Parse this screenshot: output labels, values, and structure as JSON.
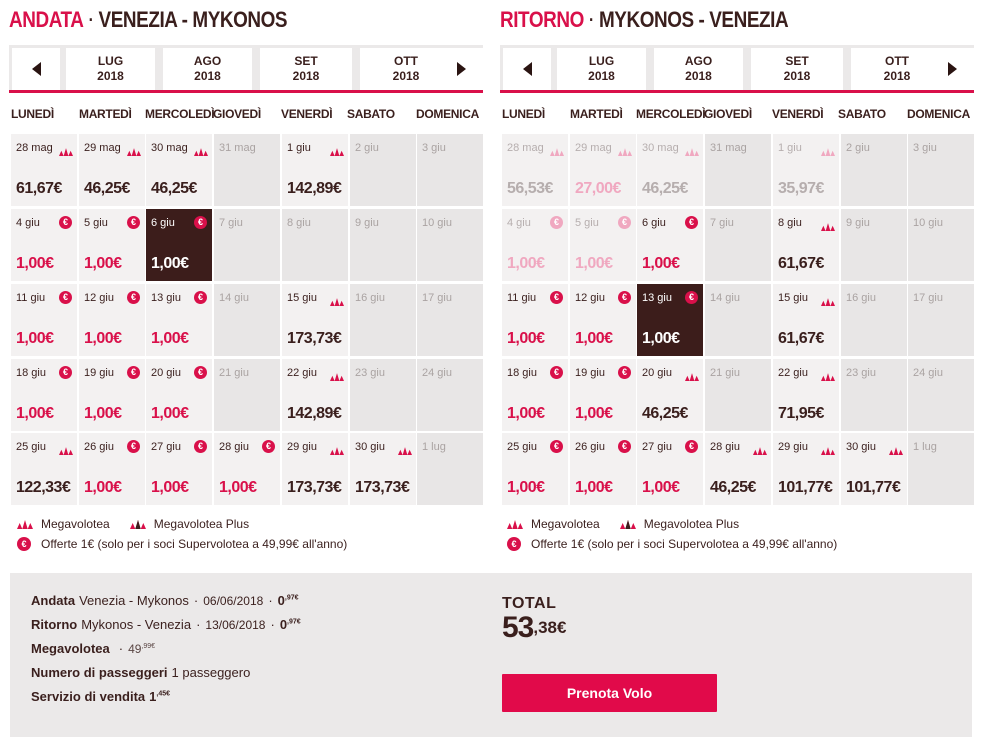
{
  "brand": {
    "accent": "#d9104a",
    "dark": "#3c1d1b",
    "cell_bg": "#f3f1f1",
    "disabled_bg": "#e8e6e6"
  },
  "outbound": {
    "lead": "ANDATA",
    "route": "VENEZIA - MYKONOS",
    "months": [
      {
        "m": "LUG",
        "y": "2018"
      },
      {
        "m": "AGO",
        "y": "2018"
      },
      {
        "m": "SET",
        "y": "2018"
      },
      {
        "m": "OTT",
        "y": "2018"
      }
    ],
    "weekdays": [
      "LUNEDÌ",
      "MARTEDÌ",
      "MERCOLEDÌ",
      "GIOVEDÌ",
      "VENERDÌ",
      "SABATO",
      "DOMENICA"
    ],
    "weeks": [
      [
        {
          "date": "28 mag",
          "price": "61,67€",
          "icon": "megavolotea"
        },
        {
          "date": "29 mag",
          "price": "46,25€",
          "icon": "megavolotea"
        },
        {
          "date": "30 mag",
          "price": "46,25€",
          "icon": "megavolotea"
        },
        {
          "date": "31 mag",
          "disabled": true
        },
        {
          "date": "1 giu",
          "price": "142,89€",
          "icon": "megavolotea"
        },
        {
          "date": "2 giu",
          "disabled": true
        },
        {
          "date": "3 giu",
          "disabled": true
        }
      ],
      [
        {
          "date": "4 giu",
          "price": "1,00€",
          "icon": "euro",
          "red": true
        },
        {
          "date": "5 giu",
          "price": "1,00€",
          "icon": "euro",
          "red": true
        },
        {
          "date": "6 giu",
          "price": "1,00€",
          "icon": "euro",
          "selected": true
        },
        {
          "date": "7 giu",
          "disabled": true
        },
        {
          "date": "8 giu",
          "disabled": true
        },
        {
          "date": "9 giu",
          "disabled": true
        },
        {
          "date": "10 giu",
          "disabled": true
        }
      ],
      [
        {
          "date": "11 giu",
          "price": "1,00€",
          "icon": "euro",
          "red": true
        },
        {
          "date": "12 giu",
          "price": "1,00€",
          "icon": "euro",
          "red": true
        },
        {
          "date": "13 giu",
          "price": "1,00€",
          "icon": "euro",
          "red": true
        },
        {
          "date": "14 giu",
          "disabled": true
        },
        {
          "date": "15 giu",
          "price": "173,73€",
          "icon": "megavolotea"
        },
        {
          "date": "16 giu",
          "disabled": true
        },
        {
          "date": "17 giu",
          "disabled": true
        }
      ],
      [
        {
          "date": "18 giu",
          "price": "1,00€",
          "icon": "euro",
          "red": true
        },
        {
          "date": "19 giu",
          "price": "1,00€",
          "icon": "euro",
          "red": true
        },
        {
          "date": "20 giu",
          "price": "1,00€",
          "icon": "euro",
          "red": true
        },
        {
          "date": "21 giu",
          "disabled": true
        },
        {
          "date": "22 giu",
          "price": "142,89€",
          "icon": "megavolotea"
        },
        {
          "date": "23 giu",
          "disabled": true
        },
        {
          "date": "24 giu",
          "disabled": true
        }
      ],
      [
        {
          "date": "25 giu",
          "price": "122,33€",
          "icon": "megavolotea"
        },
        {
          "date": "26 giu",
          "price": "1,00€",
          "icon": "euro",
          "red": true
        },
        {
          "date": "27 giu",
          "price": "1,00€",
          "icon": "euro",
          "red": true
        },
        {
          "date": "28 giu",
          "price": "1,00€",
          "icon": "euro",
          "red": true
        },
        {
          "date": "29 giu",
          "price": "173,73€",
          "icon": "megavolotea"
        },
        {
          "date": "30 giu",
          "price": "173,73€",
          "icon": "megavolotea"
        },
        {
          "date": "1 lug",
          "disabled": true
        }
      ]
    ]
  },
  "return": {
    "lead": "RITORNO",
    "route": "MYKONOS - VENEZIA",
    "months": [
      {
        "m": "LUG",
        "y": "2018"
      },
      {
        "m": "AGO",
        "y": "2018"
      },
      {
        "m": "SET",
        "y": "2018"
      },
      {
        "m": "OTT",
        "y": "2018"
      }
    ],
    "weekdays": [
      "LUNEDÌ",
      "MARTEDÌ",
      "MERCOLEDÌ",
      "GIOVEDÌ",
      "VENERDÌ",
      "SABATO",
      "DOMENICA"
    ],
    "weeks": [
      [
        {
          "date": "28 mag",
          "price": "56,53€",
          "icon": "megavolotea",
          "faded": true
        },
        {
          "date": "29 mag",
          "price": "27,00€",
          "icon": "megavolotea",
          "faded": true,
          "red": true
        },
        {
          "date": "30 mag",
          "price": "46,25€",
          "icon": "megavolotea",
          "faded": true
        },
        {
          "date": "31 mag",
          "disabled": true
        },
        {
          "date": "1 giu",
          "price": "35,97€",
          "icon": "megavolotea",
          "faded": true
        },
        {
          "date": "2 giu",
          "disabled": true
        },
        {
          "date": "3 giu",
          "disabled": true
        }
      ],
      [
        {
          "date": "4 giu",
          "price": "1,00€",
          "icon": "euro",
          "faded": true,
          "red": true
        },
        {
          "date": "5 giu",
          "price": "1,00€",
          "icon": "euro",
          "faded": true,
          "red": true
        },
        {
          "date": "6 giu",
          "price": "1,00€",
          "icon": "euro",
          "red": true
        },
        {
          "date": "7 giu",
          "disabled": true
        },
        {
          "date": "8 giu",
          "price": "61,67€",
          "icon": "megavolotea"
        },
        {
          "date": "9 giu",
          "disabled": true
        },
        {
          "date": "10 giu",
          "disabled": true
        }
      ],
      [
        {
          "date": "11 giu",
          "price": "1,00€",
          "icon": "euro",
          "red": true
        },
        {
          "date": "12 giu",
          "price": "1,00€",
          "icon": "euro",
          "red": true
        },
        {
          "date": "13 giu",
          "price": "1,00€",
          "icon": "euro",
          "selected": true
        },
        {
          "date": "14 giu",
          "disabled": true
        },
        {
          "date": "15 giu",
          "price": "61,67€",
          "icon": "megavolotea"
        },
        {
          "date": "16 giu",
          "disabled": true
        },
        {
          "date": "17 giu",
          "disabled": true
        }
      ],
      [
        {
          "date": "18 giu",
          "price": "1,00€",
          "icon": "euro",
          "red": true
        },
        {
          "date": "19 giu",
          "price": "1,00€",
          "icon": "euro",
          "red": true
        },
        {
          "date": "20 giu",
          "price": "46,25€",
          "icon": "megavolotea"
        },
        {
          "date": "21 giu",
          "disabled": true
        },
        {
          "date": "22 giu",
          "price": "71,95€",
          "icon": "megavolotea"
        },
        {
          "date": "23 giu",
          "disabled": true
        },
        {
          "date": "24 giu",
          "disabled": true
        }
      ],
      [
        {
          "date": "25 giu",
          "price": "1,00€",
          "icon": "euro",
          "red": true
        },
        {
          "date": "26 giu",
          "price": "1,00€",
          "icon": "euro",
          "red": true
        },
        {
          "date": "27 giu",
          "price": "1,00€",
          "icon": "euro",
          "red": true
        },
        {
          "date": "28 giu",
          "price": "46,25€",
          "icon": "megavolotea"
        },
        {
          "date": "29 giu",
          "price": "101,77€",
          "icon": "megavolotea"
        },
        {
          "date": "30 giu",
          "price": "101,77€",
          "icon": "megavolotea"
        },
        {
          "date": "1 lug",
          "disabled": true
        }
      ]
    ]
  },
  "legend": {
    "megavolotea": "Megavolotea",
    "megavolotea_plus": "Megavolotea Plus",
    "offer": "Offerte 1€ (solo per i soci Supervolotea a 49,99€ all'anno)"
  },
  "summary": {
    "outbound": {
      "label": "Andata",
      "route": "Venezia - Mykonos",
      "date": "06/06/2018",
      "price_int": "0",
      "price_dec": ",97€"
    },
    "return": {
      "label": "Ritorno",
      "route": "Mykonos - Venezia",
      "date": "13/06/2018",
      "price_int": "0",
      "price_dec": ",97€"
    },
    "megavolotea": {
      "label": "Megavolotea",
      "price_int": "49",
      "price_dec": ",99€"
    },
    "passengers": {
      "label": "Numero di passeggeri",
      "value": "1 passeggero"
    },
    "sales_fee": {
      "label": "Servizio di vendita",
      "price_int": "1",
      "price_dec": ",45€"
    },
    "total_label": "TOTAL",
    "total_int": "53",
    "total_dec": ",38€",
    "book_label": "Prenota Volo"
  }
}
